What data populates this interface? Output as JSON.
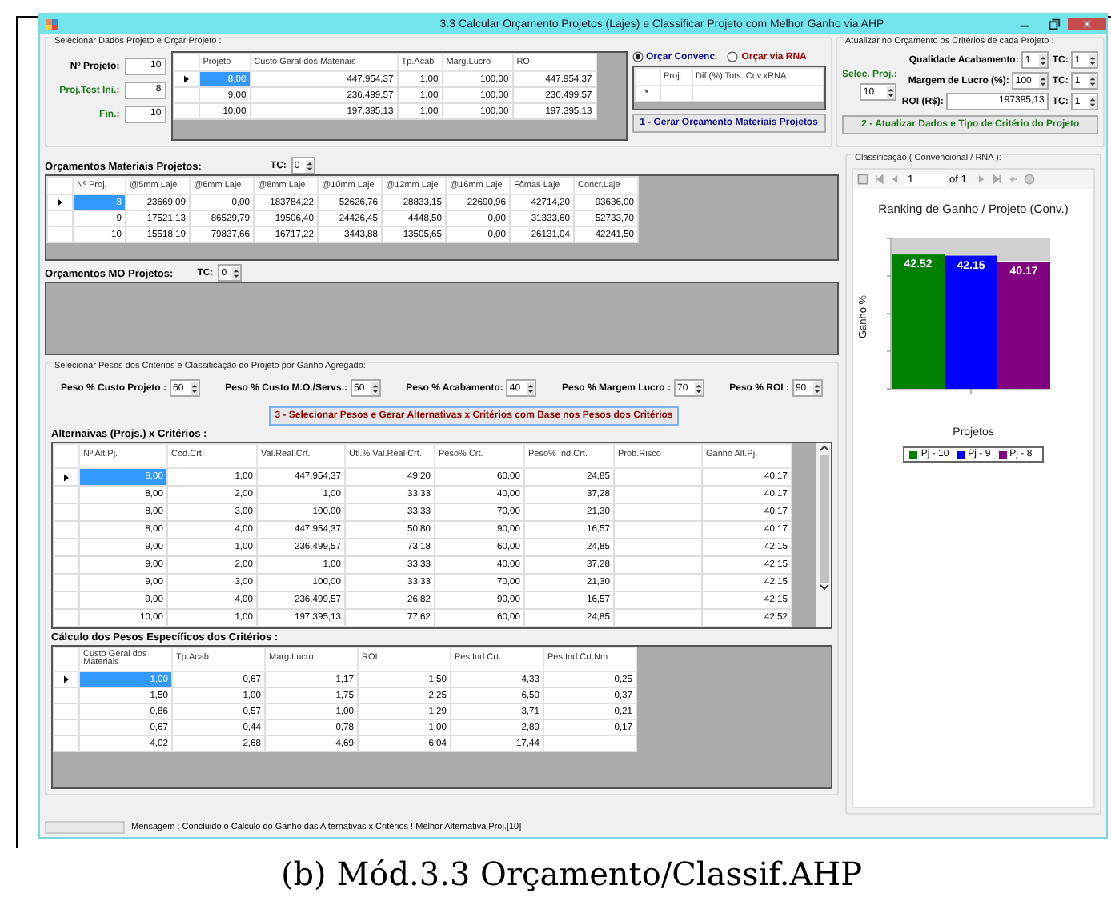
{
  "window": {
    "title": "3.3 Calcular Orçamento Projetos (Lajes) e Classificar Projeto com Melhor Ganho via AHP"
  },
  "select": {
    "legend": "Selecionar Dados Projeto e Orçar Projeto :",
    "fields": [
      {
        "label": "Nº Projeto:",
        "value": "10"
      },
      {
        "label": "Proj.Test Ini.:",
        "value": "8"
      },
      {
        "label": "Fin.:",
        "value": "10"
      }
    ],
    "grid": {
      "columns": [
        "Projeto",
        "Custo Geral dos Materiais",
        "Tp.Acab",
        "Marg.Lucro",
        "ROI"
      ],
      "rows": [
        {
          "selected": true,
          "cells": [
            "8,00",
            "447.954,37",
            "1,00",
            "100,00",
            "447.954,37"
          ]
        },
        {
          "selected": false,
          "cells": [
            "9,00",
            "236.499,57",
            "1,00",
            "100,00",
            "236.499,57"
          ]
        },
        {
          "selected": false,
          "cells": [
            "10,00",
            "197.395,13",
            "1,00",
            "100,00",
            "197.395,13"
          ]
        }
      ]
    },
    "radios": [
      {
        "label": "Orçar Convenc.",
        "selected": true
      },
      {
        "label": "Orçar via RNA",
        "selected": false
      }
    ],
    "rna_grid": {
      "columns": [
        "Proj.",
        "Dif.(%) Tots. Cnv.xRNA"
      ],
      "new_row_marker": "*"
    },
    "button": "1 - Gerar Orçamento Materiais Projetos"
  },
  "update": {
    "legend": "Atualizar no Orçamento os Critérios de cada Projeto :",
    "selec_label": "Selec. Proj.:",
    "selec_value": "10",
    "criteria": [
      {
        "kind": "spin",
        "label": "Qualidade Acabamento:",
        "value": "1",
        "tc_label": "TC:",
        "tc": "1"
      },
      {
        "kind": "spin",
        "label": "Margem de Lucro (%):",
        "value": "100",
        "tc_label": "TC:",
        "tc": "1"
      },
      {
        "kind": "text",
        "label": "ROI (R$):",
        "value": "197395,13",
        "tc_label": "TC:",
        "tc": "1"
      }
    ],
    "button": "2 - Atualizar Dados e Tipo de Critério do Projeto"
  },
  "materials": {
    "title": "Orçamentos Materiais Projetos:",
    "tc_label": "TC:",
    "tc": "0",
    "columns": [
      "Nº Proj.",
      "@5mm Laje",
      "@6mm Laje",
      "@8mm Laje",
      "@10mm Laje",
      "@12mm Laje",
      "@16mm Laje",
      "Fômas Laje",
      "Concr.Laje"
    ],
    "rows": [
      {
        "selected": true,
        "cells": [
          "8",
          "23669,09",
          "0,00",
          "183784,22",
          "52626,76",
          "28833,15",
          "22690,96",
          "42714,20",
          "93636,00"
        ]
      },
      {
        "selected": false,
        "cells": [
          "9",
          "17521,13",
          "86529,79",
          "19506,40",
          "24426,45",
          "4448,50",
          "0,00",
          "31333,60",
          "52733,70"
        ]
      },
      {
        "selected": false,
        "cells": [
          "10",
          "15518,19",
          "79837,66",
          "16717,22",
          "3443,88",
          "13505,65",
          "0,00",
          "26131,04",
          "42241,50"
        ]
      }
    ]
  },
  "mo": {
    "title": "Orçamentos MO Projetos:",
    "tc_label": "TC:",
    "tc": "0"
  },
  "weights": {
    "legend": "Selecionar Pesos dos Critérios  e  Classificação do Projeto por Ganho Agregado:",
    "items": [
      {
        "label": "Peso % Custo Projeto :",
        "value": "60"
      },
      {
        "label": "Peso % Custo M.O./Servs.:",
        "value": "50"
      },
      {
        "label": "Peso % Acabamento:",
        "value": "40"
      },
      {
        "label": "Peso % Margem Lucro :",
        "value": "70"
      },
      {
        "label": "Peso % ROI :",
        "value": "90"
      }
    ],
    "button": "3 - Selecionar Pesos e Gerar Alternativas x Critérios com Base nos Pesos dos Critérios"
  },
  "alternatives": {
    "title": "Alternaivas (Projs.) x Critérios :",
    "columns": [
      "Nº Alt.Pj.",
      "Cod.Crt.",
      "Val.Real.Crt.",
      "Utl.% Val.Real Crt.",
      "Peso% Crt.",
      "Peso% Ind.Crt.",
      "Prob.Risco",
      "Ganho Alt.Pj."
    ],
    "rows": [
      {
        "selected": true,
        "cells": [
          "8,00",
          "1,00",
          "447.954,37",
          "49,20",
          "60,00",
          "24,85",
          null,
          "40,17"
        ]
      },
      {
        "selected": false,
        "cells": [
          "8,00",
          "2,00",
          "1,00",
          "33,33",
          "40,00",
          "37,28",
          null,
          "40,17"
        ]
      },
      {
        "selected": false,
        "cells": [
          "8,00",
          "3,00",
          "100,00",
          "33,33",
          "70,00",
          "21,30",
          null,
          "40,17"
        ]
      },
      {
        "selected": false,
        "cells": [
          "8,00",
          "4,00",
          "447.954,37",
          "50,80",
          "90,00",
          "16,57",
          null,
          "40,17"
        ]
      },
      {
        "selected": false,
        "cells": [
          "9,00",
          "1,00",
          "236.499,57",
          "73,18",
          "60,00",
          "24,85",
          null,
          "42,15"
        ]
      },
      {
        "selected": false,
        "cells": [
          "9,00",
          "2,00",
          "1,00",
          "33,33",
          "40,00",
          "37,28",
          null,
          "42,15"
        ]
      },
      {
        "selected": false,
        "cells": [
          "9,00",
          "3,00",
          "100,00",
          "33,33",
          "70,00",
          "21,30",
          null,
          "42,15"
        ]
      },
      {
        "selected": false,
        "cells": [
          "9,00",
          "4,00",
          "236.499,57",
          "26,82",
          "90,00",
          "16,57",
          null,
          "42,15"
        ]
      },
      {
        "selected": false,
        "cells": [
          "10,00",
          "1,00",
          "197.395,13",
          "77,62",
          "60,00",
          "24,85",
          null,
          "42,52"
        ]
      }
    ]
  },
  "calc": {
    "title": "Cálculo dos Pesos Específicos dos Critérios :",
    "columns": [
      "Custo Geral dos Materiais",
      "Tp.Acab",
      "Marg.Lucro",
      "ROI",
      "Pes.Ind.Crt.",
      "Pes.Ind.Crt.Nm"
    ],
    "rows": [
      {
        "selected": true,
        "cells": [
          "1,00",
          "0,67",
          "1,17",
          "1,50",
          "4,33",
          "0,25"
        ]
      },
      {
        "selected": false,
        "cells": [
          "1,50",
          "1,00",
          "1,75",
          "2,25",
          "6,50",
          "0,37"
        ]
      },
      {
        "selected": false,
        "cells": [
          "0,86",
          "0,57",
          "1,00",
          "1,29",
          "3,71",
          "0,21"
        ]
      },
      {
        "selected": false,
        "cells": [
          "0,67",
          "0,44",
          "0,78",
          "1,00",
          "2,89",
          "0,17"
        ]
      },
      {
        "selected": false,
        "cells": [
          "4,02",
          "2,68",
          "4,69",
          "6,04",
          "17,44",
          null
        ]
      }
    ]
  },
  "classification": {
    "legend": "Classificação ( Convencional  / RNA ):",
    "page": "1",
    "page_of": "of 1",
    "chart_data": {
      "type": "bar",
      "title": "Ranking de Ganho / Projeto (Conv.)",
      "xlabel": "Projetos",
      "ylabel": "Ganho %",
      "data_labels": true,
      "legend": "bottom",
      "series": [
        {
          "name": "Pj - 10",
          "color": "#008000",
          "values": [
            42.52
          ]
        },
        {
          "name": "Pj - 9",
          "color": "#0000ff",
          "values": [
            42.15
          ]
        },
        {
          "name": "Pj - 8",
          "color": "#800080",
          "values": [
            40.17
          ]
        }
      ]
    }
  },
  "status_bar": {
    "progress": {
      "level": 0
    },
    "message": "Mensagem : Concluido o Calculo do Ganho das Alternativas x Critérios ! Melhor Alternativa Proj.[10]"
  },
  "caption": "(b) Mód.3.3 Orçamento/Classif.AHP"
}
